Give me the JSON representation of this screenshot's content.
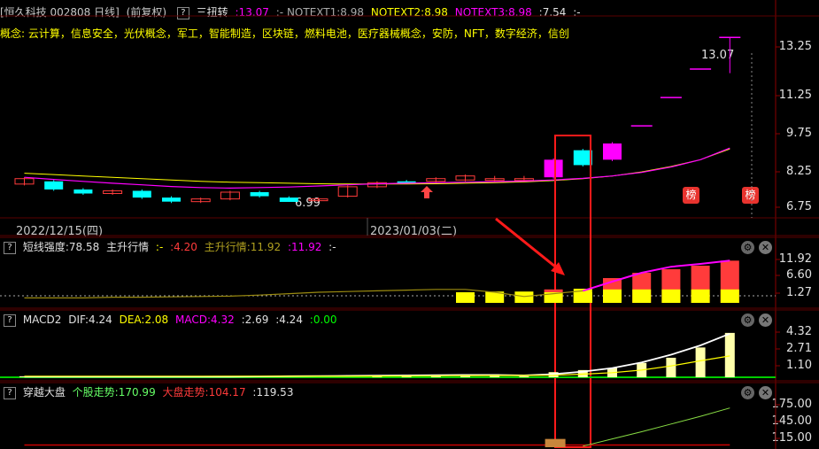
{
  "header": {
    "stock": "[恒久科技 002808 日线]",
    "adjust": "(前复权)",
    "q": "?",
    "ind_name": "三扭转",
    "ind_val": ":13.07",
    "n1": ":- NOTEXT1:8.98",
    "n2": "NOTEXT2:8.98",
    "n3": "NOTEXT3:8.98",
    "n4": ":7.54",
    "n5": ":-",
    "concepts": "概念: 云计算，信息安全，光伏概念，军工，智能制造，区块链，燃料电池，医疗器械概念，安防，NFT，数字经济，信创"
  },
  "main_axis": [
    "13.25",
    "11.25",
    "9.75",
    "8.25",
    "6.75"
  ],
  "annotations": {
    "high": "13.07",
    "low": "6.99",
    "bang": "榜"
  },
  "dates": [
    "2022/12/15(四)",
    "2023/01/03(二)"
  ],
  "panel2": {
    "q": "?",
    "name": "短线强度:78.58",
    "p1": "主升行情",
    "p2": ":-",
    "p3": ":4.20",
    "p4": "主升行情:11.92",
    "p5": ":11.92",
    "p6": ":-",
    "axis": [
      "11.92",
      "6.60",
      "1.27"
    ]
  },
  "panel3": {
    "q": "?",
    "name": "MACD2",
    "dif": "DIF:4.24",
    "dea": "DEA:2.08",
    "macd": "MACD:4.32",
    "v1": ":2.69",
    "v2": ":4.24",
    "v3": ":0.00",
    "axis": [
      "4.32",
      "2.71",
      "1.10"
    ]
  },
  "panel4": {
    "q": "?",
    "name": "穿越大盘",
    "s1": "个股走势:170.99",
    "s2": "大盘走势:104.17",
    "s3": ":119.53",
    "axis": [
      "175.00",
      "145.00",
      "115.00"
    ]
  },
  "buttons": {
    "gear": "⚙",
    "close": "✕"
  },
  "colors": {
    "up": "#ff3b3b",
    "down": "#00ffff",
    "magenta": "#ff00ff",
    "yellow": "#ffff00",
    "green": "#00ff00"
  },
  "chart_data": [
    {
      "type": "candlestick",
      "title": "恒久科技 002808 日线",
      "ylim": [
        6.4,
        13.8
      ],
      "candles": [
        {
          "o": 7.85,
          "c": 7.65,
          "h": 7.9,
          "l": 7.6,
          "col": "up"
        },
        {
          "o": 7.75,
          "c": 7.45,
          "h": 7.8,
          "l": 7.4,
          "col": "down"
        },
        {
          "o": 7.45,
          "c": 7.3,
          "h": 7.5,
          "l": 7.25,
          "col": "down"
        },
        {
          "o": 7.3,
          "c": 7.4,
          "h": 7.45,
          "l": 7.25,
          "col": "up"
        },
        {
          "o": 7.4,
          "c": 7.15,
          "h": 7.45,
          "l": 7.1,
          "col": "down"
        },
        {
          "o": 7.15,
          "c": 7.0,
          "h": 7.2,
          "l": 6.95,
          "col": "down"
        },
        {
          "o": 7.0,
          "c": 7.1,
          "h": 7.15,
          "l": 6.95,
          "col": "up"
        },
        {
          "o": 7.1,
          "c": 7.35,
          "h": 7.4,
          "l": 7.05,
          "col": "up"
        },
        {
          "o": 7.35,
          "c": 7.2,
          "h": 7.4,
          "l": 7.15,
          "col": "down"
        },
        {
          "o": 7.15,
          "c": 6.99,
          "h": 7.2,
          "l": 6.99,
          "col": "down"
        },
        {
          "o": 7.05,
          "c": 7.1,
          "h": 7.15,
          "l": 7.0,
          "col": "up"
        },
        {
          "o": 7.2,
          "c": 7.55,
          "h": 7.6,
          "l": 7.15,
          "col": "up"
        },
        {
          "o": 7.55,
          "c": 7.7,
          "h": 7.75,
          "l": 7.5,
          "col": "up"
        },
        {
          "o": 7.7,
          "c": 7.75,
          "h": 7.8,
          "l": 7.65,
          "col": "down"
        },
        {
          "o": 7.75,
          "c": 7.85,
          "h": 7.9,
          "l": 7.7,
          "col": "up"
        },
        {
          "o": 7.8,
          "c": 7.95,
          "h": 8.0,
          "l": 7.75,
          "col": "up"
        },
        {
          "o": 7.8,
          "c": 7.85,
          "h": 7.95,
          "l": 7.75,
          "col": "up"
        },
        {
          "o": 7.8,
          "c": 7.85,
          "h": 7.95,
          "l": 7.75,
          "col": "up"
        },
        {
          "o": 7.9,
          "c": 8.55,
          "h": 8.6,
          "l": 7.85,
          "col": "magenta"
        },
        {
          "o": 8.35,
          "c": 8.9,
          "h": 8.95,
          "l": 8.3,
          "col": "down"
        },
        {
          "o": 8.55,
          "c": 9.15,
          "h": 9.2,
          "l": 8.5,
          "col": "magenta"
        },
        {
          "o": 9.8,
          "c": 9.8,
          "h": 9.8,
          "l": 9.8,
          "col": "magenta"
        },
        {
          "o": 10.85,
          "c": 10.85,
          "h": 10.85,
          "l": 10.85,
          "col": "magenta"
        },
        {
          "o": 11.9,
          "c": 11.9,
          "h": 11.9,
          "l": 11.9,
          "col": "magenta"
        },
        {
          "o": 13.07,
          "c": 13.07,
          "h": 13.07,
          "l": 11.75,
          "col": "magenta"
        }
      ],
      "ma_yellow": [
        8.05,
        8.0,
        7.95,
        7.9,
        7.85,
        7.8,
        7.75,
        7.72,
        7.7,
        7.68,
        7.66,
        7.65,
        7.65,
        7.65,
        7.66,
        7.68,
        7.7,
        7.73,
        7.78,
        7.85,
        7.95,
        8.1,
        8.3,
        8.55,
        8.95
      ],
      "ma_purple": [
        7.9,
        7.82,
        7.75,
        7.68,
        7.62,
        7.56,
        7.52,
        7.5,
        7.52,
        7.54,
        7.58,
        7.62,
        7.66,
        7.68,
        7.7,
        7.72,
        7.74,
        7.76,
        7.8,
        7.86,
        7.95,
        8.08,
        8.28,
        8.55,
        8.98
      ]
    },
    {
      "type": "bar",
      "title": "短线强度",
      "ylim": [
        0,
        14
      ],
      "values": [
        0,
        0,
        0,
        0,
        0,
        0,
        0,
        0,
        0,
        0,
        0,
        0,
        0,
        0,
        0,
        0,
        0,
        0,
        3.8,
        3.0,
        7.0,
        8.5,
        9.5,
        10.5,
        11.92
      ],
      "yellow_base": [
        0,
        0,
        0,
        0,
        0,
        0,
        0,
        0,
        0,
        0,
        0,
        0,
        0,
        0,
        0,
        3.0,
        3.2,
        3.2,
        3.0,
        4.0,
        3.8,
        3.8,
        3.8,
        3.8,
        3.8
      ],
      "line": [
        1.4,
        1.4,
        1.4,
        1.6,
        1.6,
        1.7,
        1.8,
        1.9,
        2.2,
        2.6,
        3.0,
        3.2,
        3.4,
        3.6,
        3.8,
        3.8,
        3.0,
        1.8,
        2.6,
        3.4,
        6.0,
        8.5,
        10.2,
        11.0,
        11.92
      ]
    },
    {
      "type": "bar",
      "title": "MACD2",
      "ylim": [
        0,
        5
      ],
      "values": [
        0.1,
        0,
        0,
        0,
        0,
        0,
        0,
        0,
        0,
        0,
        0,
        0,
        0.2,
        0.25,
        0.25,
        0.3,
        0.3,
        0.1,
        0.5,
        0.7,
        0.9,
        1.4,
        1.9,
        2.9,
        4.32
      ],
      "dif": [
        0.05,
        0.05,
        0.05,
        0.05,
        0.05,
        0.05,
        0.05,
        0.06,
        0.08,
        0.1,
        0.12,
        0.14,
        0.16,
        0.18,
        0.2,
        0.22,
        0.22,
        0.18,
        0.3,
        0.55,
        0.9,
        1.45,
        2.2,
        3.1,
        4.24
      ],
      "dea": [
        0.1,
        0.1,
        0.1,
        0.1,
        0.1,
        0.1,
        0.1,
        0.1,
        0.1,
        0.1,
        0.1,
        0.1,
        0.12,
        0.13,
        0.15,
        0.16,
        0.17,
        0.17,
        0.2,
        0.3,
        0.45,
        0.7,
        1.1,
        1.6,
        2.08
      ]
    },
    {
      "type": "line",
      "title": "穿越大盘",
      "ylim": [
        100,
        185
      ],
      "stock": [
        null,
        null,
        null,
        null,
        null,
        null,
        null,
        null,
        null,
        null,
        null,
        null,
        null,
        null,
        null,
        null,
        null,
        null,
        null,
        102,
        115,
        128,
        142,
        156,
        170.99
      ],
      "market": [
        104,
        104,
        104,
        104,
        104,
        104,
        104,
        104,
        104,
        104,
        104,
        104,
        104,
        104,
        104,
        104,
        104,
        104,
        104,
        104,
        104,
        104,
        104,
        104,
        104.17
      ],
      "highlight_bar": {
        "index": 18,
        "value": 115
      }
    }
  ]
}
